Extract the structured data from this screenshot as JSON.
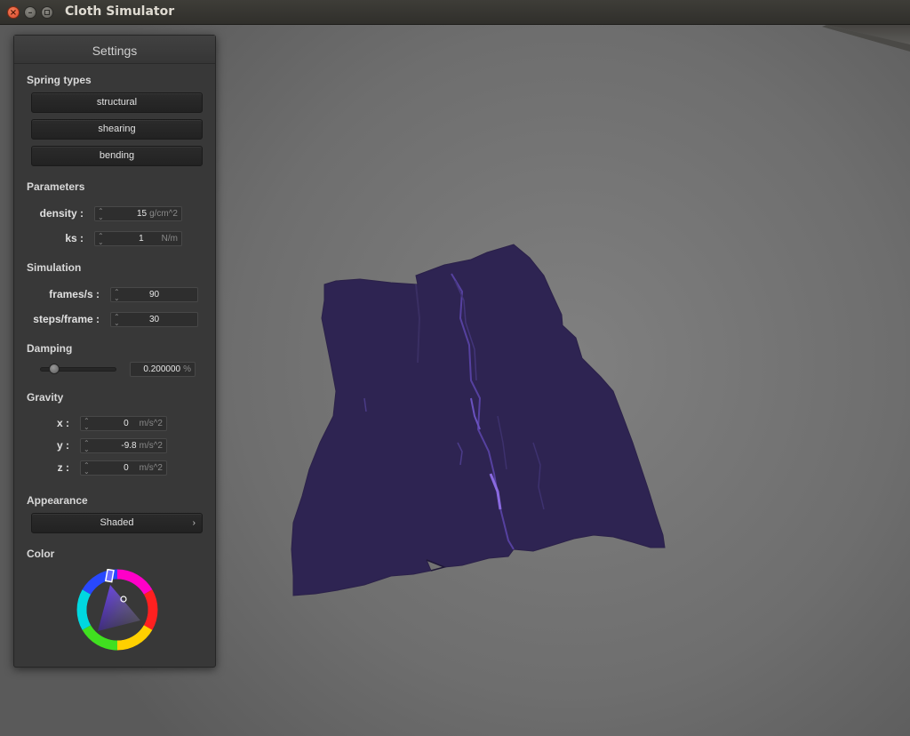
{
  "window": {
    "title": "Cloth Simulator",
    "close_glyph": "×",
    "min_glyph": "–"
  },
  "panel": {
    "header": "Settings",
    "spring_types": {
      "label": "Spring types",
      "buttons": [
        "structural",
        "shearing",
        "bending"
      ]
    },
    "parameters": {
      "label": "Parameters",
      "density": {
        "label": "density :",
        "value": "15",
        "unit": "g/cm^2"
      },
      "ks": {
        "label": "ks :",
        "value": "1",
        "unit": "N/m"
      }
    },
    "simulation": {
      "label": "Simulation",
      "fps": {
        "label": "frames/s :",
        "value": "90"
      },
      "steps": {
        "label": "steps/frame :",
        "value": "30"
      }
    },
    "damping": {
      "label": "Damping",
      "slider_level": 0.2,
      "value": "0.200000",
      "unit": "%"
    },
    "gravity": {
      "label": "Gravity",
      "x": {
        "label": "x :",
        "value": "0",
        "unit": "m/s^2"
      },
      "y": {
        "label": "y :",
        "value": "-9.8",
        "unit": "m/s^2"
      },
      "z": {
        "label": "z :",
        "value": "0",
        "unit": "m/s^2"
      }
    },
    "appearance": {
      "label": "Appearance",
      "selected": "Shaded",
      "chevron": "›"
    },
    "color": {
      "label": "Color",
      "cloth_color": "#2e2452"
    }
  },
  "icons": {
    "close": "close-icon",
    "minimize": "minimize-icon",
    "maximize": "maximize-icon",
    "spin": "spinner-arrows-icon",
    "chevron": "chevron-right-icon"
  },
  "colors": {
    "panel_bg": "#383838",
    "button_bg": "#252525",
    "cloth": "#2e2452",
    "cloth_highlight": "#7a5cd0"
  }
}
